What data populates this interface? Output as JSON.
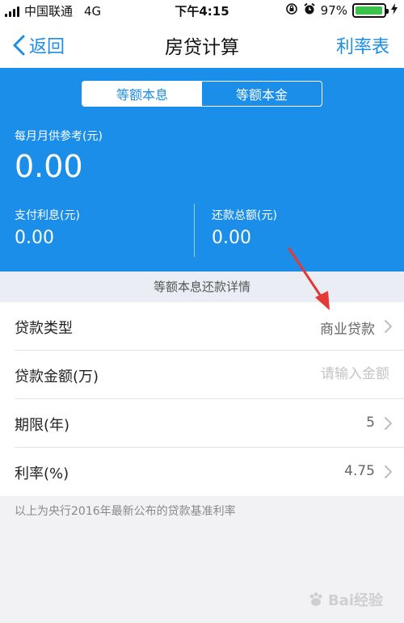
{
  "status_bar": {
    "carrier": "中国联通",
    "network": "4G",
    "time": "下午4:15",
    "battery_percent": "97%",
    "battery_level": 0.97,
    "icons": [
      "signal-icon",
      "rotation-lock-icon",
      "alarm-icon",
      "battery-icon",
      "charging-icon"
    ]
  },
  "nav": {
    "back_label": "返回",
    "title": "房贷计算",
    "right_label": "利率表"
  },
  "summary": {
    "segments": [
      "等额本息",
      "等额本金"
    ],
    "active_segment": "等额本息",
    "monthly_label": "每月月供参考(元)",
    "monthly_value": "0.00",
    "interest_label": "支付利息(元)",
    "interest_value": "0.00",
    "total_label": "还款总额(元)",
    "total_value": "0.00"
  },
  "details_header": "等额本息还款详情",
  "form": {
    "rows": [
      {
        "label": "贷款类型",
        "value": "商业贷款"
      },
      {
        "label": "贷款金额(万)",
        "placeholder": "请输入金额"
      },
      {
        "label": "期限(年)",
        "value": "5"
      },
      {
        "label": "利率(%)",
        "value": "4.75"
      }
    ]
  },
  "footnote": "以上为央行2016年最新公布的贷款基准利率",
  "watermark": "Bai经验",
  "colors": {
    "accent": "#1a8ee8",
    "annotation": "#e53935",
    "battery": "#3bc34a"
  }
}
